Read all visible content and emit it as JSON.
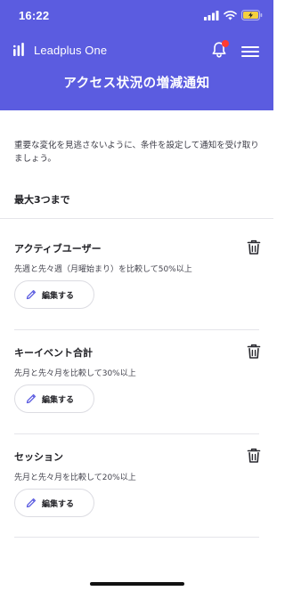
{
  "status_bar": {
    "time": "16:22"
  },
  "app": {
    "brand_name": "Leadplus One",
    "page_title": "アクセス状況の増減通知",
    "colors": {
      "header": "#5b5ce0",
      "notification_dot": "#ff3b30",
      "edit_icon": "#5b5ce0"
    }
  },
  "content": {
    "description": "重要な変化を見逃さないように、条件を設定して通知を受け取りましょう。",
    "limit_label": "最大3つまで",
    "edit_label": "編集する",
    "alerts": [
      {
        "title": "アクティブユーザー",
        "condition": "先週と先々週（月曜始まり）を比較して50%以上"
      },
      {
        "title": "キーイベント合計",
        "condition": "先月と先々月を比較して30%以上"
      },
      {
        "title": "セッション",
        "condition": "先月と先々月を比較して20%以上"
      }
    ]
  },
  "icons": {
    "bell": "bell-icon",
    "menu": "hamburger-menu-icon",
    "trash": "trash-icon",
    "edit": "pencil-icon"
  }
}
